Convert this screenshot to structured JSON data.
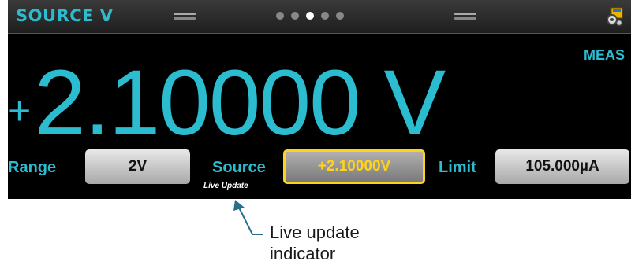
{
  "header": {
    "title": "SOURCE V",
    "pager_dots": 5,
    "active_dot": 3,
    "icons": [
      "swipe-left-handle-icon",
      "swipe-right-handle-icon",
      "system-event-icon"
    ]
  },
  "main": {
    "mode_label": "MEAS",
    "reading_sign": "+",
    "reading_value": "2.10000 V"
  },
  "controls": {
    "range_label": "Range",
    "range_value": "2V",
    "source_label": "Source",
    "source_value": "+2.10000V",
    "live_update_text": "Live Update",
    "limit_label": "Limit",
    "limit_value": "105.000µA"
  },
  "annotation": {
    "line1": "Live update",
    "line2": "indicator"
  },
  "colors": {
    "accent": "#2bbcd0",
    "highlight": "#ffd21c",
    "panel": "#000000"
  }
}
